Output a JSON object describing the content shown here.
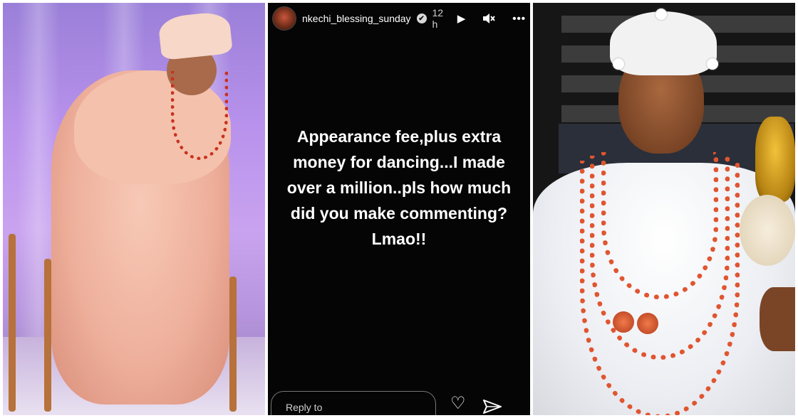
{
  "story": {
    "username": "nkechi_blessing_sunday",
    "verified_mark": "✔",
    "time": "12 h",
    "play_icon": "▶",
    "mute_icon": "🔇",
    "more_icon": "•••",
    "text": "Appearance fee,plus extra money for dancing...I made over a million..pls  how much did you make commenting? Lmao!!",
    "reply_placeholder": "Reply to",
    "heart_icon": "♡"
  },
  "icons": {
    "avatar": "avatar-image",
    "verified": "verified-badge-icon",
    "play": "play-icon",
    "mute": "mute-icon",
    "more": "more-options-icon",
    "heart": "heart-icon",
    "send": "send-icon"
  },
  "colors": {
    "story_background": "#050505",
    "text": "#ffffff",
    "beads": "#e05530"
  }
}
